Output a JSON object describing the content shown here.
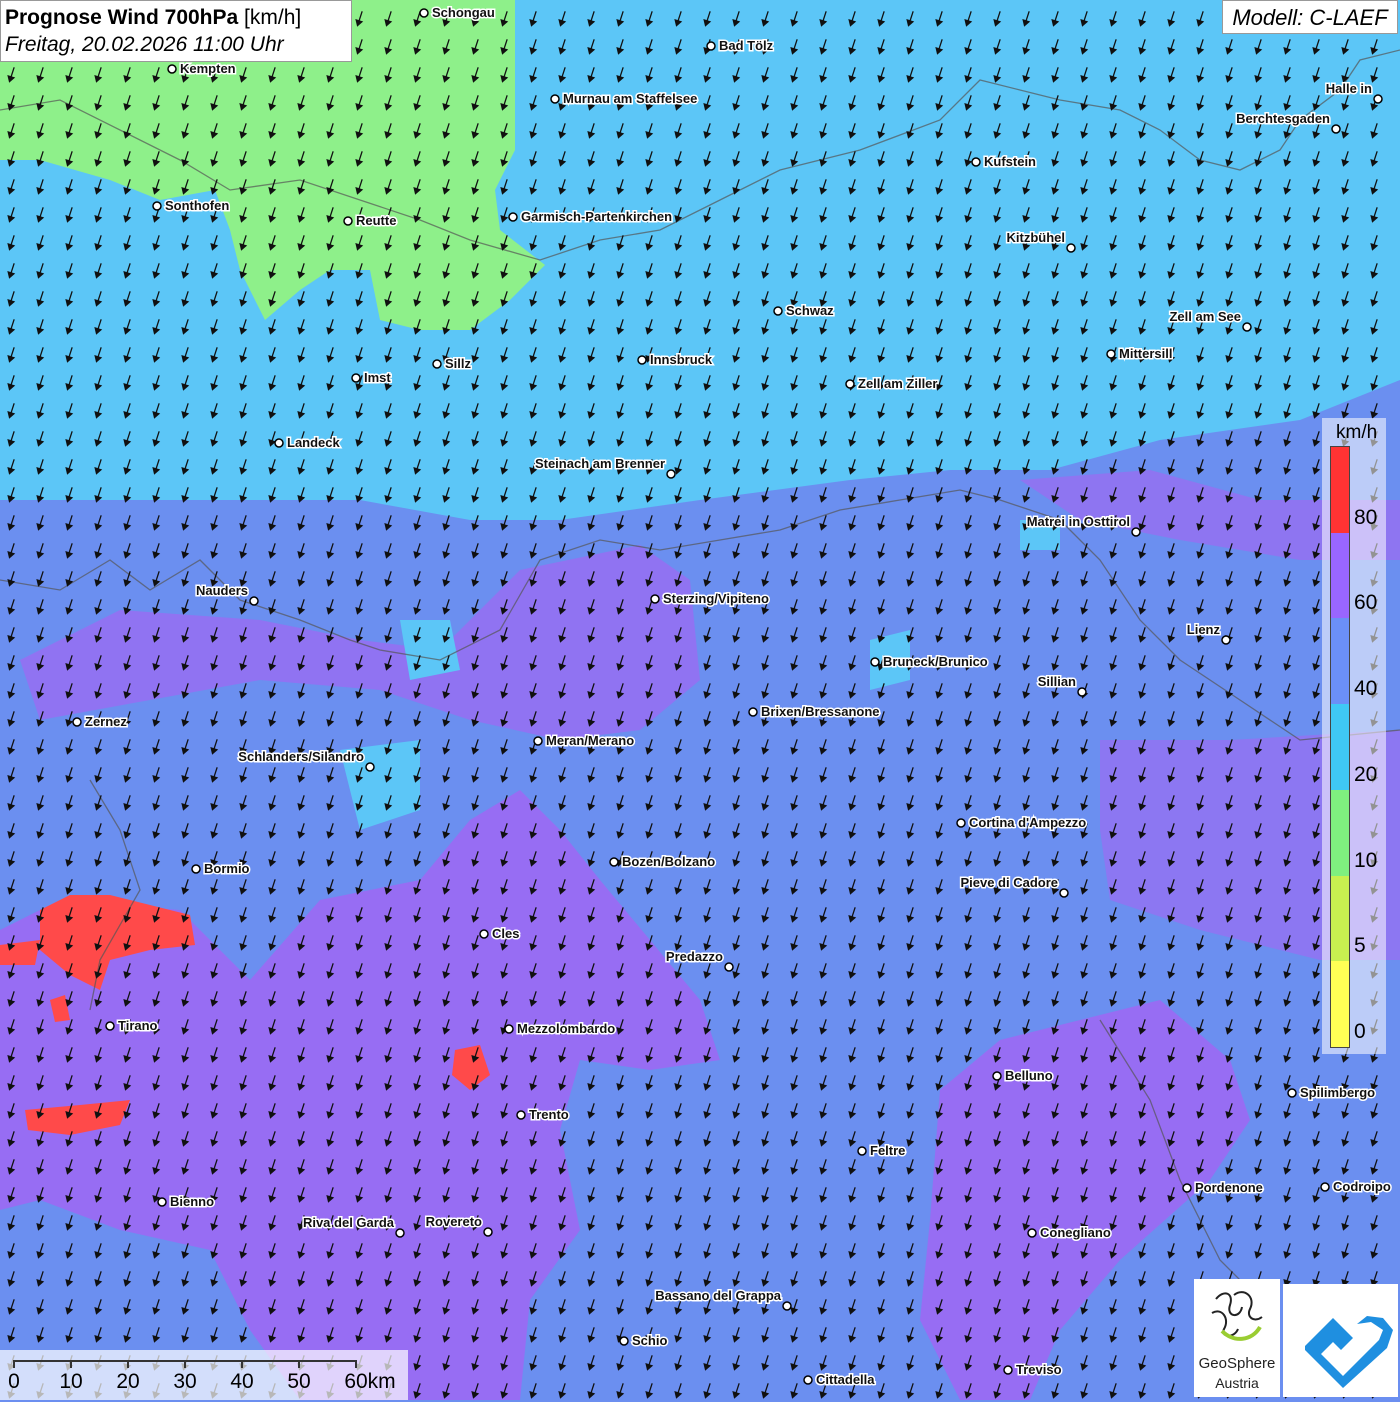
{
  "header": {
    "title_bold": "Prognose Wind 700hPa",
    "title_unit": "[km/h]",
    "subtitle": "Freitag, 20.02.2026 11:00 Uhr"
  },
  "model": {
    "label": "Modell: C-LAEF"
  },
  "legend": {
    "unit": "km/h",
    "ticks": [
      "80",
      "60",
      "40",
      "20",
      "10",
      "5",
      "0"
    ],
    "colors": [
      "#ff3333",
      "#9966ff",
      "#6b8ff7",
      "#3fc8f5",
      "#7ff07f",
      "#c8f050",
      "#ffff55"
    ]
  },
  "wind": {
    "direction": "from north-northeast",
    "field_colors": {
      "green": "#8ef08a",
      "cyan": "#5cc6f7",
      "blue": "#6b8ff0",
      "purple": "#9a6cf2",
      "red": "#ff4a4a"
    }
  },
  "scalebar": {
    "labels": [
      "0",
      "10",
      "20",
      "30",
      "40",
      "50",
      "60km"
    ]
  },
  "logos": {
    "geosphere_line1": "GeoSphere",
    "geosphere_line2": "Austria"
  },
  "cities": [
    {
      "name": "Schongau"
    },
    {
      "name": "Kempten"
    },
    {
      "name": "Bad Tölz"
    },
    {
      "name": "Murnau am Staffelsee"
    },
    {
      "name": "Halle in"
    },
    {
      "name": "Berchtesgaden"
    },
    {
      "name": "Kufstein"
    },
    {
      "name": "Sonthofen"
    },
    {
      "name": "Reutte"
    },
    {
      "name": "Garmisch-Partenkirchen"
    },
    {
      "name": "Kitzbühel"
    },
    {
      "name": "Schwaz"
    },
    {
      "name": "Zell am See"
    },
    {
      "name": "Mittersill"
    },
    {
      "name": "Sillz"
    },
    {
      "name": "Imst"
    },
    {
      "name": "Innsbruck"
    },
    {
      "name": "Zell am Ziller"
    },
    {
      "name": "Landeck"
    },
    {
      "name": "Steinach am Brenner"
    },
    {
      "name": "Matrei in Osttirol"
    },
    {
      "name": "Nauders"
    },
    {
      "name": "Sterzing/Vipiteno"
    },
    {
      "name": "Lienz"
    },
    {
      "name": "Bruneck/Brunico"
    },
    {
      "name": "Sillian"
    },
    {
      "name": "Zernez"
    },
    {
      "name": "Brixen/Bressanone"
    },
    {
      "name": "Meran/Merano"
    },
    {
      "name": "Schlanders/Silandro"
    },
    {
      "name": "Cortina d'Ampezzo"
    },
    {
      "name": "Bozen/Bolzano"
    },
    {
      "name": "Bormio"
    },
    {
      "name": "Pieve di Cadore"
    },
    {
      "name": "Cles"
    },
    {
      "name": "Predazzo"
    },
    {
      "name": "Tirano"
    },
    {
      "name": "Mezzolombardo"
    },
    {
      "name": "Belluno"
    },
    {
      "name": "Spilimbergo"
    },
    {
      "name": "Trento"
    },
    {
      "name": "Feltre"
    },
    {
      "name": "Pordenone"
    },
    {
      "name": "Codroipo"
    },
    {
      "name": "Bienno"
    },
    {
      "name": "Riva del Garda"
    },
    {
      "name": "Rovereto"
    },
    {
      "name": "Conegliano"
    },
    {
      "name": "Bassano del Grappa"
    },
    {
      "name": "Schio"
    },
    {
      "name": "Treviso"
    },
    {
      "name": "Cittadella"
    }
  ]
}
